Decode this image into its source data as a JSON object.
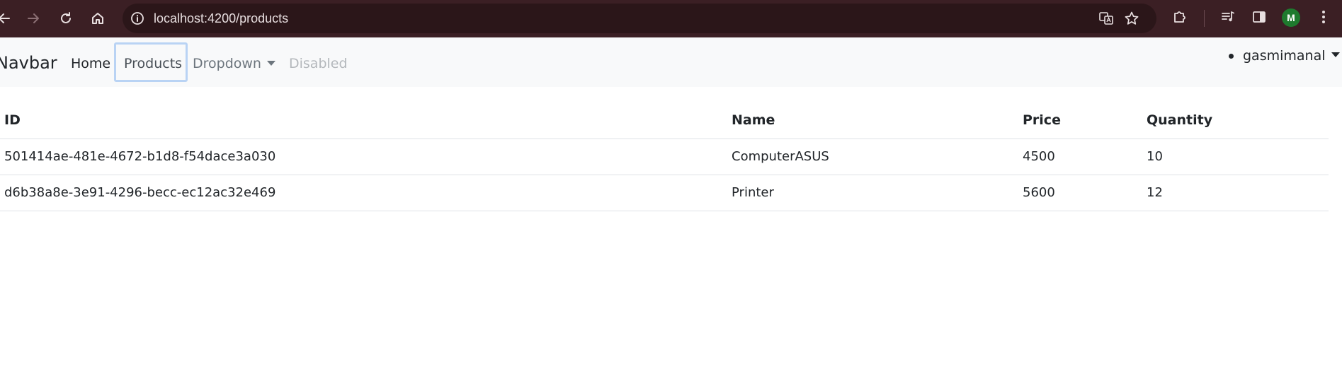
{
  "browser": {
    "url": "localhost:4200/products",
    "profile_initial": "M",
    "icons": {
      "back": "arrow-left-icon",
      "forward": "arrow-right-icon",
      "reload": "reload-icon",
      "home": "home-icon",
      "site_info": "info-icon",
      "translate": "translate-icon",
      "bookmark": "star-icon",
      "extensions": "puzzle-icon",
      "media": "music-queue-icon",
      "side_panel": "side-panel-icon",
      "menu": "kebab-menu-icon"
    },
    "colors": {
      "bar": "#3b1f24",
      "omnibox": "#2b1619",
      "avatar": "#1e7a2e"
    }
  },
  "navbar": {
    "brand": "Navbar",
    "links": {
      "home": "Home",
      "products": "Products",
      "dropdown": "Dropdown",
      "disabled": "Disabled"
    },
    "user": "gasmimanal"
  },
  "table": {
    "headers": {
      "id": "ID",
      "name": "Name",
      "price": "Price",
      "quantity": "Quantity"
    },
    "rows": [
      {
        "id": "501414ae-481e-4672-b1d8-f54dace3a030",
        "name": "ComputerASUS",
        "price": "4500",
        "quantity": "10"
      },
      {
        "id": "d6b38a8e-3e91-4296-becc-ec12ac32e469",
        "name": "Printer",
        "price": "5600",
        "quantity": "12"
      }
    ]
  }
}
